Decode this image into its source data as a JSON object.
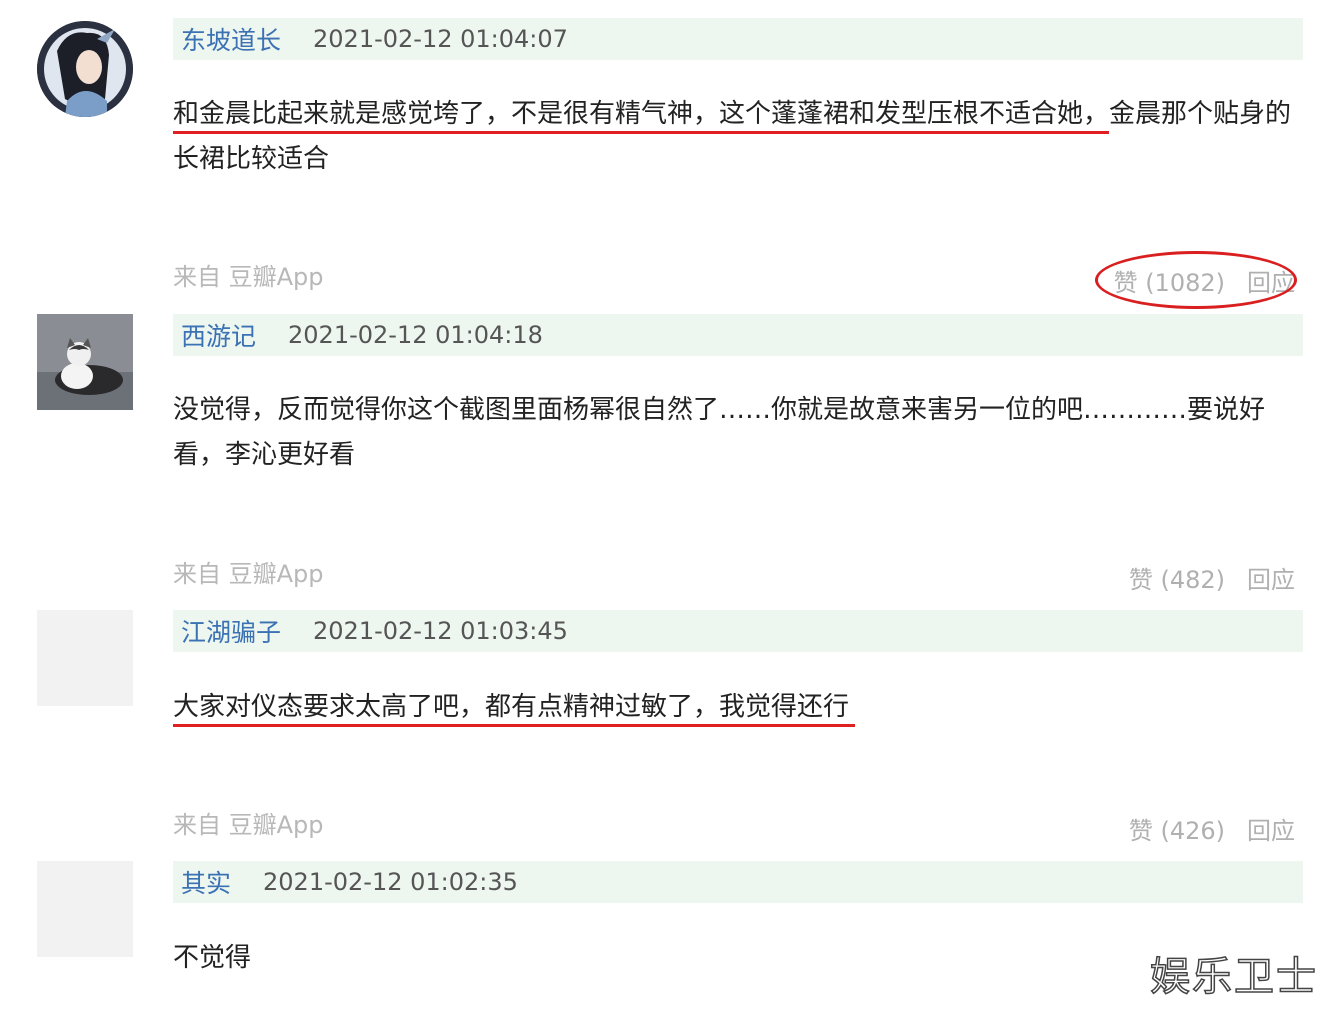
{
  "comments": [
    {
      "author": "东坡道长",
      "time": "2021-02-12 01:04:07",
      "content_underlined": "和金晨比起来就是感觉垮了，不是很有精气神，这个蓬蓬裙和发型压根不适合她，",
      "content_rest": "金晨那个贴身的长裙比较适合",
      "source": "来自 豆瓣App",
      "like_label": "赞 (1082)",
      "reply_label": "回应"
    },
    {
      "author": "西游记",
      "time": "2021-02-12 01:04:18",
      "content": "没觉得，反而觉得你这个截图里面杨幂很自然了……你就是故意来害另一位的吧…………要说好看，李沁更好看",
      "source": "来自 豆瓣App",
      "like_label": "赞 (482)",
      "reply_label": "回应"
    },
    {
      "author": "江湖骗子",
      "time": "2021-02-12 01:03:45",
      "content": "大家对仪态要求太高了吧，都有点精神过敏了，我觉得还行",
      "source": "来自 豆瓣App",
      "like_label": "赞 (426)",
      "reply_label": "回应"
    },
    {
      "author": "其实",
      "time": "2021-02-12 01:02:35",
      "content": "不觉得"
    }
  ],
  "watermark": "娱乐卫士",
  "colors": {
    "author": "#3a72b4",
    "header_bg": "#eef6f0",
    "annotation_red": "#e02020"
  }
}
